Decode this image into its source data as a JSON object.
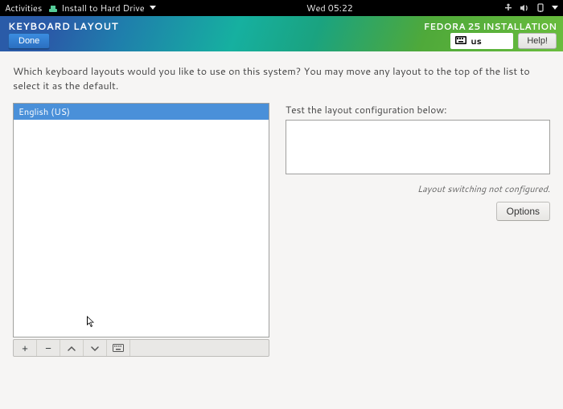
{
  "topbar": {
    "activities": "Activities",
    "app_name": "Install to Hard Drive",
    "clock": "Wed 05:22"
  },
  "header": {
    "title": "KEYBOARD LAYOUT",
    "product": "FEDORA 25 INSTALLATION",
    "done_label": "Done",
    "help_label": "Help!",
    "layout_code": "us"
  },
  "body": {
    "instruction": "Which keyboard layouts would you like to use on this system?  You may move any layout to the top of the list to select it as the default.",
    "layouts": [
      "English (US)"
    ],
    "toolbar": {
      "add": "+",
      "remove": "−",
      "up": "",
      "down": "",
      "preview": ""
    },
    "test_label": "Test the layout configuration below:",
    "test_value": "",
    "switch_note": "Layout switching not configured.",
    "options_label": "Options"
  }
}
